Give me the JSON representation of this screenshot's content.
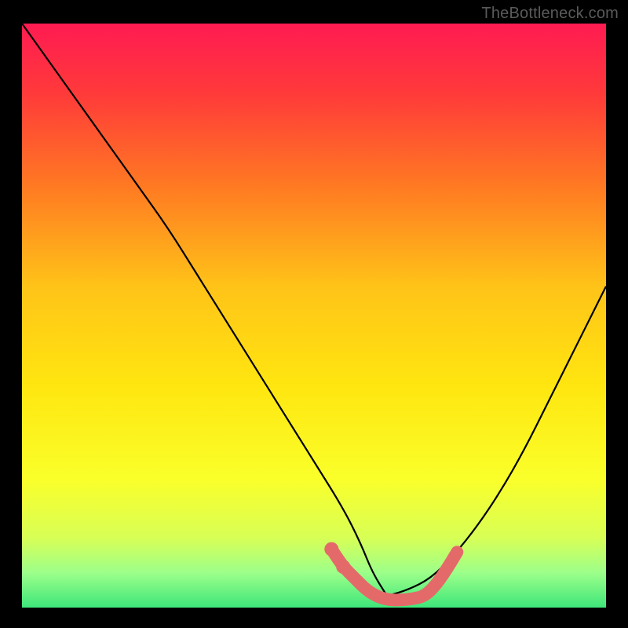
{
  "watermark": "TheBottleneck.com",
  "gradient": {
    "stops": [
      {
        "offset": 0.0,
        "color": "#ff1b52"
      },
      {
        "offset": 0.12,
        "color": "#ff3a3a"
      },
      {
        "offset": 0.28,
        "color": "#ff7a22"
      },
      {
        "offset": 0.45,
        "color": "#ffc318"
      },
      {
        "offset": 0.62,
        "color": "#ffe610"
      },
      {
        "offset": 0.78,
        "color": "#faff2a"
      },
      {
        "offset": 0.88,
        "color": "#d8ff55"
      },
      {
        "offset": 0.94,
        "color": "#9dff8a"
      },
      {
        "offset": 1.0,
        "color": "#3ee67a"
      }
    ]
  },
  "chart_data": {
    "type": "line",
    "title": "",
    "xlabel": "",
    "ylabel": "",
    "xlim": [
      0,
      100
    ],
    "ylim": [
      0,
      100
    ],
    "series": [
      {
        "name": "curve-left",
        "x": [
          0,
          5,
          10,
          15,
          20,
          25,
          30,
          35,
          40,
          45,
          50,
          55,
          58,
          60,
          62.5
        ],
        "y": [
          100,
          93,
          86,
          79,
          72,
          65,
          57,
          49,
          41,
          33,
          25,
          17,
          11,
          6,
          2
        ]
      },
      {
        "name": "curve-right",
        "x": [
          62.5,
          66,
          70,
          74,
          78,
          82,
          86,
          90,
          94,
          98,
          100
        ],
        "y": [
          2,
          3,
          5,
          9,
          14,
          20,
          27,
          35,
          43,
          51,
          55
        ]
      }
    ],
    "highlight": {
      "name": "bottom-band",
      "x": [
        53,
        55,
        57,
        59,
        61,
        63,
        65,
        67,
        69,
        71,
        73,
        74.5
      ],
      "y": [
        10,
        7,
        5,
        3,
        1.8,
        1.3,
        1.3,
        1.5,
        2,
        4,
        7,
        9.5
      ]
    }
  }
}
